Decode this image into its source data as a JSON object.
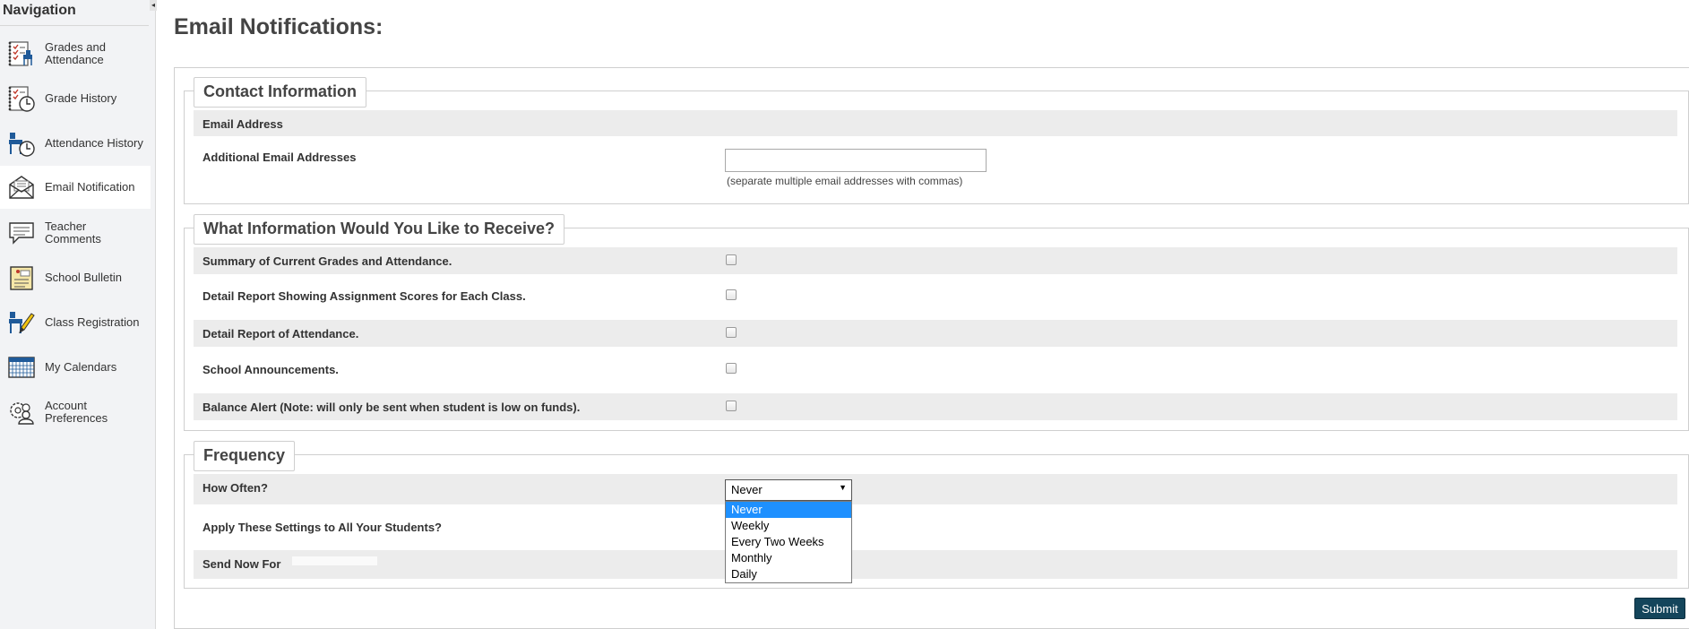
{
  "sidebar": {
    "title": "Navigation",
    "collapse_glyph": "◂",
    "items": [
      {
        "label": "Grades and Attendance",
        "icon": "gradebook-icon"
      },
      {
        "label": "Grade History",
        "icon": "grade-history-icon"
      },
      {
        "label": "Attendance History",
        "icon": "attendance-history-icon"
      },
      {
        "label": "Email Notification",
        "icon": "envelope-icon",
        "active": true
      },
      {
        "label": "Teacher Comments",
        "icon": "speech-bubble-icon"
      },
      {
        "label": "School Bulletin",
        "icon": "bulletin-icon"
      },
      {
        "label": "Class Registration",
        "icon": "registration-pencil-icon"
      },
      {
        "label": "My Calendars",
        "icon": "calendar-icon"
      },
      {
        "label": "Account Preferences",
        "icon": "preferences-icon"
      }
    ]
  },
  "page": {
    "title": "Email Notifications:"
  },
  "contact": {
    "legend": "Contact Information",
    "email_label": "Email Address",
    "additional_label": "Additional Email Addresses",
    "additional_value": "",
    "hint": "(separate multiple email addresses with commas)"
  },
  "info": {
    "legend": "What Information Would You Like to Receive?",
    "items": [
      {
        "label": "Summary of Current Grades and Attendance.",
        "checked": false
      },
      {
        "label": "Detail Report Showing Assignment Scores for Each Class.",
        "checked": false
      },
      {
        "label": "Detail Report of Attendance.",
        "checked": false
      },
      {
        "label": "School Announcements.",
        "checked": false
      },
      {
        "label": "Balance Alert (Note: will only be sent when student is low on funds).",
        "checked": false
      }
    ]
  },
  "frequency": {
    "legend": "Frequency",
    "how_often_label": "How Often?",
    "selected": "Never",
    "options": [
      "Never",
      "Weekly",
      "Every Two Weeks",
      "Monthly",
      "Daily"
    ],
    "apply_label": "Apply These Settings to All Your Students?",
    "send_now_label": "Send Now For"
  },
  "actions": {
    "submit_label": "Submit"
  },
  "colors": {
    "sidebar_bg": "#f2f3f5",
    "row_shade": "#ececec",
    "selected_option": "#1e90ff",
    "submit_bg": "#14455b",
    "icon_blue": "#1f5a99"
  }
}
